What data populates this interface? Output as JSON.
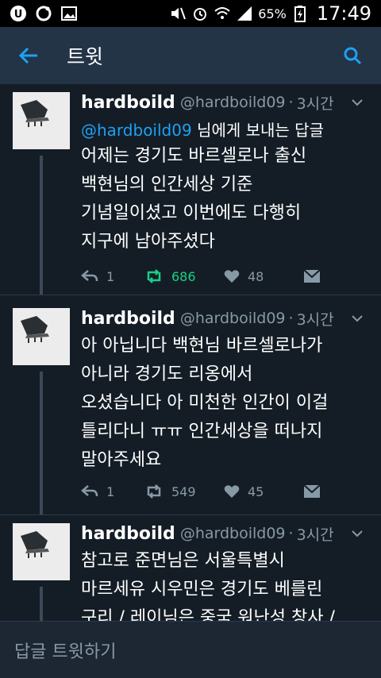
{
  "status_bar": {
    "battery": "65%",
    "time": "17:49"
  },
  "appbar": {
    "title": "트윗"
  },
  "tweets": [
    {
      "name": "hardboild",
      "handle": "@hardboild09",
      "dot": "·",
      "time": "3시간",
      "reply_mention": "@hardboild09",
      "reply_rest": " 님에게 보내는 답글",
      "lines": [
        "어제는 경기도 바르셀로나 출신",
        "백현님의 인간세상 기준",
        "기념일이셨고 이번에도 다행히",
        "지구에 남아주셨다"
      ],
      "replies": "1",
      "retweets": "686",
      "likes": "48"
    },
    {
      "name": "hardboild",
      "handle": "@hardboild09",
      "dot": "·",
      "time": "3시간",
      "lines": [
        "아 아닙니다 백현님 바르셀로나가",
        "아니라 경기도 리옹에서",
        "오셨습니다 아 미천한 인간이 이걸",
        "틀리다니 ㅠㅠ 인간세상을 떠나지",
        "말아주세요"
      ],
      "replies": "1",
      "retweets": "549",
      "likes": "45"
    },
    {
      "name": "hardboild",
      "handle": "@hardboild09",
      "dot": "·",
      "time": "3시간",
      "lines": [
        "참고로 준면님은 서울특별시",
        "마르세유 시우민은 경기도 베를린",
        "구리 / 레이님은 중국 워난성 창사 /"
      ]
    }
  ],
  "composer": {
    "placeholder": "답글 트윗하기"
  },
  "colors": {
    "background": "#141d26",
    "appbar": "#243447",
    "accent": "#1da1f2",
    "retweet_active": "#19cf86",
    "secondary_text": "#8899a6"
  }
}
